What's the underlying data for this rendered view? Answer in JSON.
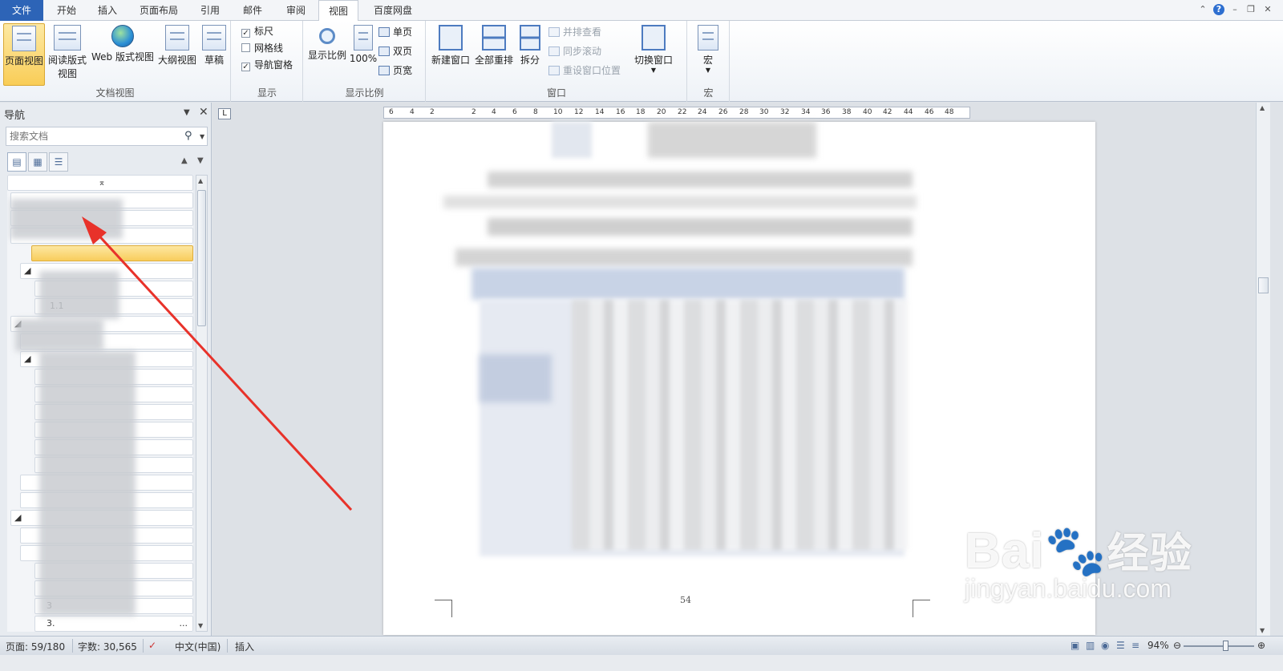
{
  "tabs": [
    {
      "label": "文件"
    },
    {
      "label": "开始"
    },
    {
      "label": "插入"
    },
    {
      "label": "页面布局"
    },
    {
      "label": "引用"
    },
    {
      "label": "邮件"
    },
    {
      "label": "审阅"
    },
    {
      "label": "视图"
    },
    {
      "label": "百度网盘"
    }
  ],
  "active_tab": "视图",
  "ribbon": {
    "doc_views": {
      "label": "文档视图",
      "buttons": [
        {
          "label": "页面视图",
          "icon": "page-view-icon",
          "active": true
        },
        {
          "label": "阅读版式",
          "label2": "视图",
          "icon": "reading-view-icon"
        },
        {
          "label": "Web 版式视图",
          "icon": "web-view-icon"
        },
        {
          "label": "大纲视图",
          "icon": "outline-view-icon"
        },
        {
          "label": "草稿",
          "icon": "draft-view-icon"
        }
      ]
    },
    "show": {
      "label": "显示",
      "items": [
        {
          "label": "标尺",
          "checked": true
        },
        {
          "label": "网格线",
          "checked": false
        },
        {
          "label": "导航窗格",
          "checked": true
        }
      ]
    },
    "zoom": {
      "label": "显示比例",
      "zoom_button": "显示比例",
      "hundred_button": "100%",
      "small": [
        "单页",
        "双页",
        "页宽"
      ]
    },
    "window": {
      "label": "窗口",
      "new_window": "新建窗口",
      "arrange_all": "全部重排",
      "split": "拆分",
      "small": [
        "并排查看",
        "同步滚动",
        "重设窗口位置"
      ],
      "switch": "切换窗口"
    },
    "macros": {
      "label": "宏",
      "button": "宏"
    }
  },
  "nav": {
    "title": "导航",
    "search_placeholder": "搜索文档",
    "items": [
      "1.1",
      "3",
      "3.",
      "..."
    ]
  },
  "document": {
    "page_number": "54",
    "ruler_ticks": [
      "6",
      "4",
      "2",
      "",
      "2",
      "4",
      "6",
      "8",
      "10",
      "12",
      "14",
      "16",
      "18",
      "20",
      "22",
      "24",
      "26",
      "28",
      "30",
      "32",
      "34",
      "36",
      "38",
      "40",
      "42",
      "44",
      "46",
      "48"
    ]
  },
  "statusbar": {
    "page": "页面: 59/180",
    "words": "字数: 30,565",
    "language": "中文(中国)",
    "mode": "插入",
    "zoom": "94%"
  },
  "watermark": {
    "brand": "Bai",
    "brand_cn": "经验",
    "sub": "jingyan.baidu.com"
  },
  "colors": {
    "file_tab": "#2d64b7",
    "selection": "#f8cd5c",
    "arrow": "#e8322a"
  }
}
